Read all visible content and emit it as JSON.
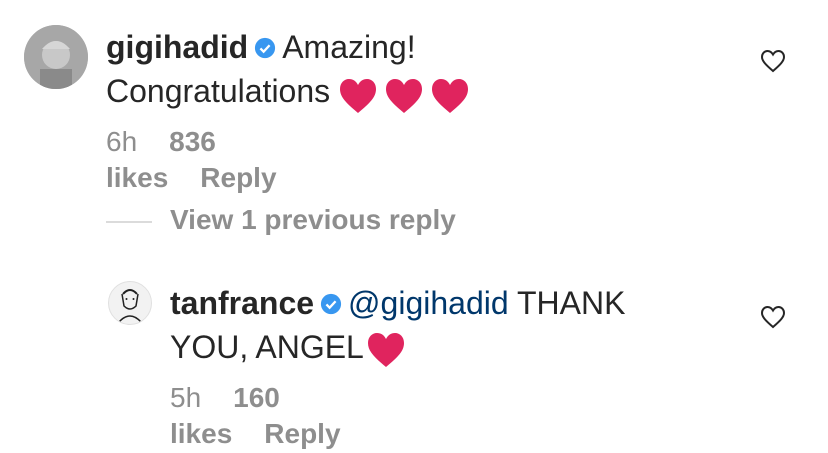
{
  "comment": {
    "username": "gigihadid",
    "text_line1": "Amazing!",
    "text_line2": "Congratulations",
    "hearts": [
      "❤",
      "❤",
      "❤"
    ],
    "time": "6h",
    "likes": "836 likes",
    "reply_label": "Reply"
  },
  "view_replies": {
    "label": "View 1 previous reply"
  },
  "reply": {
    "username": "tanfrance",
    "mention": "@gigihadid",
    "text_line1": "THANK",
    "text_line2": "YOU, ANGEL",
    "time": "5h",
    "likes": "160 likes",
    "reply_label": "Reply"
  },
  "colors": {
    "verified": "#3897f0",
    "heart": "#e0245e",
    "mention": "#00376b",
    "meta": "#8e8e8e"
  }
}
